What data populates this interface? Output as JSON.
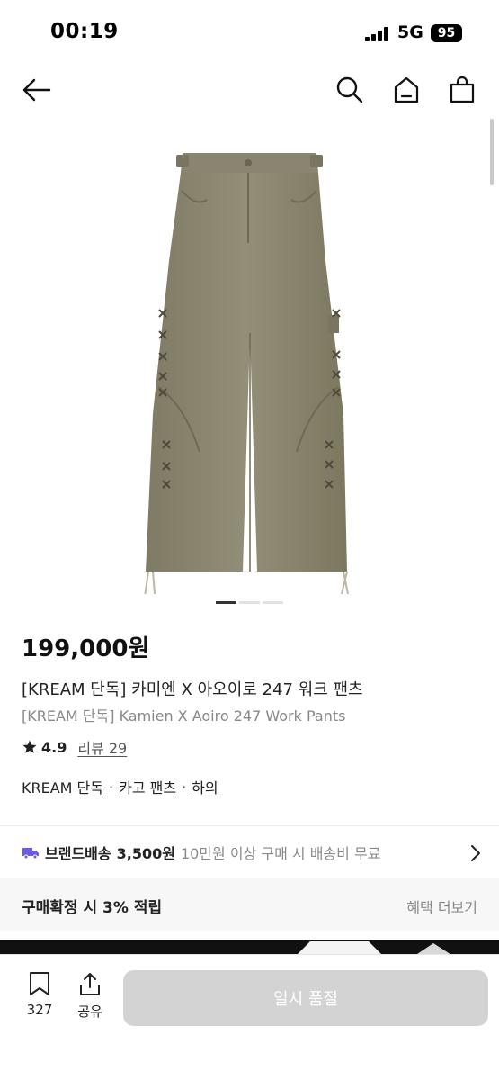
{
  "status_bar": {
    "time": "00:19",
    "network": "5G",
    "battery": "95"
  },
  "header": {
    "back_icon": "arrow-left-icon",
    "search_icon": "search-icon",
    "home_icon": "home-icon",
    "cart_icon": "shopping-bag-icon"
  },
  "gallery": {
    "page_count": 3,
    "current_page": 1
  },
  "product": {
    "price": "199,000원",
    "title_ko": "[KREAM 단독] 카미엔 X 아오이로 247 워크 팬츠",
    "title_en": "[KREAM 단독] Kamien X Aoiro 247 Work Pants",
    "rating": "4.9",
    "review_label": "리뷰 29",
    "categories": [
      "KREAM 단독",
      "카고 팬츠",
      "하의"
    ]
  },
  "delivery": {
    "label": "브랜드배송",
    "price": "3,500원",
    "note": "10만원 이상 구매 시 배송비 무료"
  },
  "points": {
    "text": "구매확정 시 3% 적립",
    "link": "혜택 더보기"
  },
  "bottom_bar": {
    "bookmark_count": "327",
    "share_label": "공유",
    "soldout_label": "일시 품절"
  },
  "colors": {
    "pants": "#8c8770",
    "soldout_button": "#d3d3d3",
    "delivery_truck": "#6b5ce7"
  }
}
